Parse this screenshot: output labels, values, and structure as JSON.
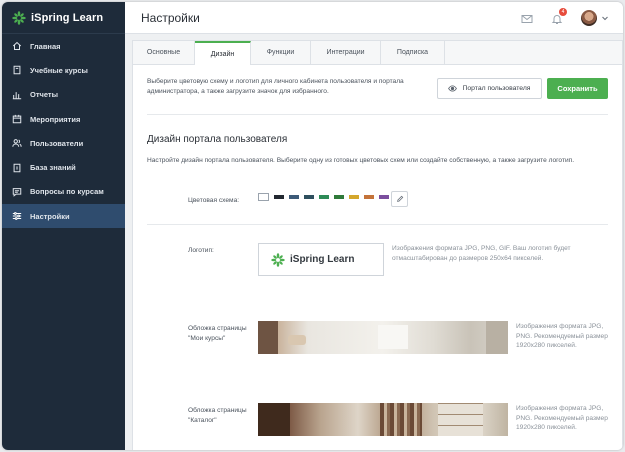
{
  "brand": {
    "name": "iSpring Learn",
    "color": "#4caf50"
  },
  "sidebar": {
    "items": [
      {
        "label": "Главная",
        "icon": "home-icon"
      },
      {
        "label": "Учебные курсы",
        "icon": "book-icon"
      },
      {
        "label": "Отчеты",
        "icon": "chart-icon"
      },
      {
        "label": "Мероприятия",
        "icon": "calendar-icon"
      },
      {
        "label": "Пользователи",
        "icon": "users-icon"
      },
      {
        "label": "База знаний",
        "icon": "knowledge-icon"
      },
      {
        "label": "Вопросы по курсам",
        "icon": "chat-icon"
      },
      {
        "label": "Настройки",
        "icon": "sliders-icon",
        "active": true
      }
    ]
  },
  "header": {
    "title": "Настройки",
    "notifications_count": "4"
  },
  "tabs": [
    {
      "label": "Основные"
    },
    {
      "label": "Дизайн",
      "active": true
    },
    {
      "label": "Функции"
    },
    {
      "label": "Интеграции"
    },
    {
      "label": "Подписка"
    }
  ],
  "intro": "Выберите цветовую схему и логотип для личного кабинета пользователя и портала администратора, а также загрузите значок для избранного.",
  "buttons": {
    "portal": "Портал пользователя",
    "save": "Сохранить"
  },
  "section": {
    "title": "Дизайн портала пользователя",
    "description": "Настройте дизайн портала пользователя. Выберите одну из готовых цветовых схем или создайте собственную, а также загрузите логотип."
  },
  "color_scheme": {
    "label": "Цветовая схема:",
    "swatches": [
      "#ffffff",
      "#222831",
      "#3c5a78",
      "#2e4f5e",
      "#2e8b57",
      "#2f7a3a",
      "#d4a72c",
      "#c4733a",
      "#7b4e9e"
    ]
  },
  "logo": {
    "label": "Логотип:",
    "text": "iSpring Learn",
    "hint": "Изображения формата JPG, PNG, GIF. Ваш логотип будет отмасштабирован до размеров 250x64 пикселей."
  },
  "cover_my_courses": {
    "label": "Обложка страницы \"Мои курсы\"",
    "hint": "Изображения формата JPG, PNG. Рекомендуемый размер 1920x280 пикселей."
  },
  "cover_catalog": {
    "label": "Обложка страницы \"Каталог\"",
    "hint": "Изображения формата JPG, PNG. Рекомендуемый размер 1920x280 пикселей."
  }
}
